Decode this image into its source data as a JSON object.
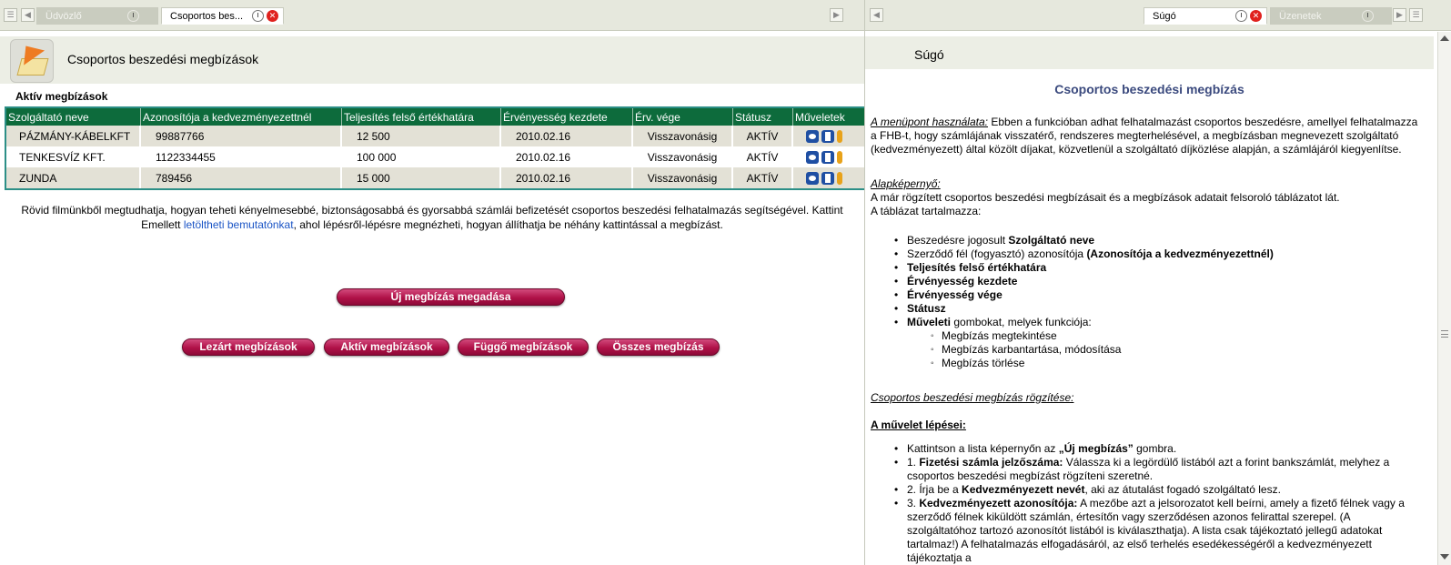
{
  "left_tabs": [
    {
      "label": "Üdvözlő",
      "active": false
    },
    {
      "label": "Csoportos bes...",
      "active": true
    }
  ],
  "right_tabs": [
    {
      "label": "Súgó",
      "active": true
    },
    {
      "label": "Üzenetek",
      "active": false
    }
  ],
  "left_pane": {
    "title": "Csoportos beszedési megbízások",
    "section_title": "Aktív megbízások",
    "table": {
      "columns": [
        "Szolgáltató neve",
        "Azonosítója a kedvezményezettnél",
        "Teljesítés felső értékhatára",
        "Érvényesség kezdete",
        "Érv. vége",
        "Státusz",
        "Műveletek"
      ],
      "rows": [
        {
          "provider": "PÁZMÁNY-KÁBELKFT",
          "id": "99887766",
          "limit": "12 500",
          "start": "2010.02.16",
          "end": "Visszavonásig",
          "status": "AKTÍV"
        },
        {
          "provider": "TENKESVÍZ KFT.",
          "id": "1122334455",
          "limit": "100 000",
          "start": "2010.02.16",
          "end": "Visszavonásig",
          "status": "AKTÍV"
        },
        {
          "provider": "ZUNDA",
          "id": "789456",
          "limit": "15 000",
          "start": "2010.02.16",
          "end": "Visszavonásig",
          "status": "AKTÍV"
        }
      ]
    },
    "info_line1": "Rövid filmünkből megtudhatja, hogyan teheti kényelmesebbé, biztonságosabbá és gyorsabbá számlái befizetését csoportos beszedési felhatalmazás segítségével. Kattint",
    "info_line2_prefix": "Emellett ",
    "info_link": "letöltheti bemutatónkat",
    "info_line2_suffix": ", ahol lépésről-lépésre megnézheti, hogyan állíthatja be néhány kattintással a megbízást.",
    "buttons": {
      "new": "Új megbízás megadása",
      "closed": "Lezárt megbízások",
      "active": "Aktív megbízások",
      "pending": "Függő megbízások",
      "all": "Összes megbízás"
    }
  },
  "right_pane": {
    "title": "Súgó",
    "heading": "Csoportos beszedési megbízás",
    "usage_label": "A menüpont használata:",
    "usage_text": " Ebben a funkcióban adhat felhatalmazást csoportos beszedésre, amellyel felhatalmazza a FHB-t, hogy számlájának visszatérő, rendszeres megterhelésével, a megbízásban megnevezett szolgáltató (kedvezményezett) által közölt díjakat, közvetlenül a szolgáltató díjközlése alapján, a számlájáról kiegyenlítse.",
    "base_label": "Alapképernyő:",
    "base_text1": "A már rögzített csoportos beszedési megbízásait és a megbízások adatait felsoroló táblázatot lát.",
    "base_text2": "A táblázat tartalmazza:",
    "list": [
      {
        "plain": "Beszedésre jogosult ",
        "bold": "Szolgáltató neve"
      },
      {
        "plain": "Szerződő fél (fogyasztó) azonosítója ",
        "bold": "(Azonosítója a kedvezményezettnél)"
      },
      {
        "plain": "",
        "bold": "Teljesítés felső értékhatára"
      },
      {
        "plain": "",
        "bold": "Érvényesség kezdete"
      },
      {
        "plain": "",
        "bold": "Érvényesség vége"
      },
      {
        "plain": "",
        "bold": "Státusz"
      },
      {
        "plain": " gombokat, melyek funkciója:",
        "bold": "Műveleti"
      }
    ],
    "sublist": [
      "Megbízás megtekintése",
      "Megbízás karbantartása, módosítása",
      "Megbízás törlése"
    ],
    "record_label": "Csoportos beszedési megbízás rögzítése:",
    "steps_label": "A művelet lépései:",
    "step0_a": "Kattintson a lista képernyőn az ",
    "step0_b": "„Új megbízás”",
    "step0_c": " gombra.",
    "step1_num": "1. ",
    "step1_bold": "Fizetési számla jelzőszáma:",
    "step1_text": " Válassza ki a legördülő listából azt a forint bankszámlát, melyhez a csoportos beszedési megbízást rögzíteni szeretné.",
    "step2_a": "2. Írja be a ",
    "step2_bold": "Kedvezményezett nevét",
    "step2_c": ", aki az átutalást fogadó szolgáltató lesz.",
    "step3_num": "3. ",
    "step3_bold": "Kedvezményezett azonosítója:",
    "step3_text": " A mezőbe azt a jelsorozatot kell beírni, amely a fizető félnek vagy a szerződő félnek kiküldött számlán, értesítőn vagy szerződésen azonos felirattal szerepel. (A szolgáltatóhoz tartozó azonosítót listából is kiválaszthatja). A lista csak tájékoztató jellegű adatokat tartalmaz!) A felhatalmazás elfogadásáról, az első terhelés esedékességéről a kedvezményezett tájékoztatja a"
  },
  "colors": {
    "table_header": "#0d6b3c",
    "button": "#b01147",
    "heading": "#3b4a7e",
    "link": "#1a54c5"
  }
}
